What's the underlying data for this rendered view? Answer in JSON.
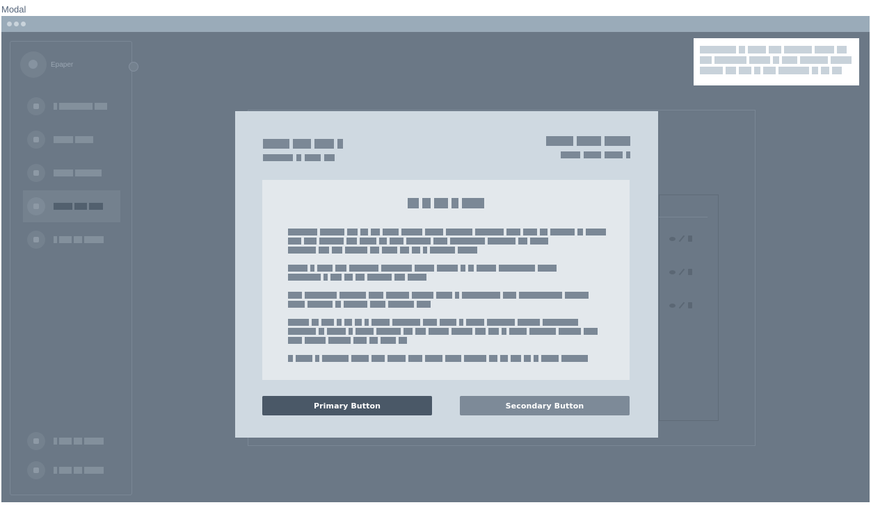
{
  "page_label": "Modal",
  "app": {
    "brand_name": "Epaper"
  },
  "modal": {
    "primary_button_label": "Primary Button",
    "secondary_button_label": "Secondary Button"
  },
  "colors": {
    "backdrop": "#6b7886",
    "modal_bg": "#cfd9e1",
    "document_bg": "#e3e8ec",
    "primary_button": "#4a5867",
    "secondary_button": "#7d8a98",
    "placeholder_text": "#7b8896"
  },
  "icons": {
    "sidebar": [
      "user-icon",
      "clock-icon",
      "lightbulb-icon",
      "share-icon",
      "bell-icon",
      "profile-icon",
      "location-icon"
    ],
    "row_actions": [
      "eye-icon",
      "pencil-icon",
      "trash-icon"
    ]
  }
}
